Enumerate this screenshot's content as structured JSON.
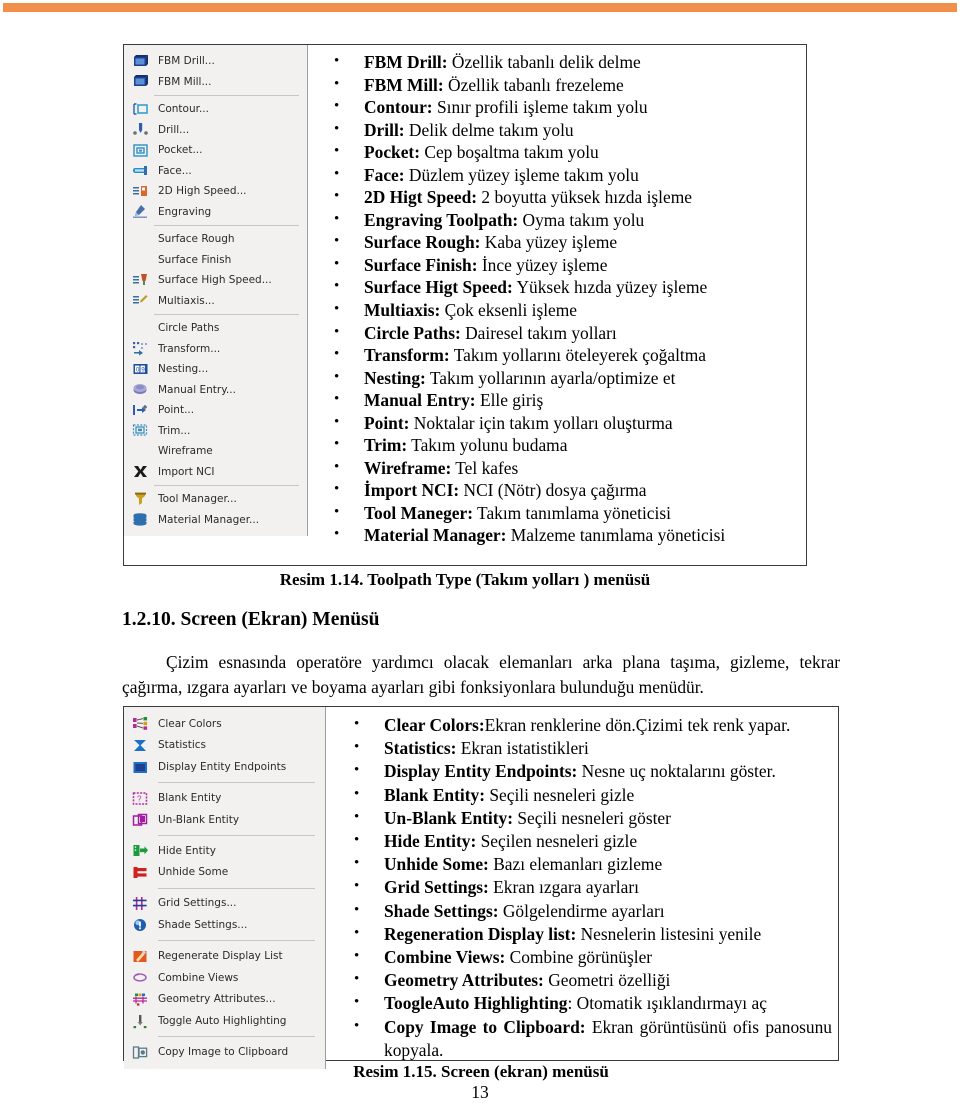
{
  "page": {
    "number": "13",
    "accent_color": "#F2904B",
    "panel_background": "#F2F1F0"
  },
  "figure1": {
    "caption": "Resim 1.14. Toolpath Type (Takım yolları ) menüsü",
    "menu": {
      "groups": [
        {
          "items": [
            {
              "label": "FBM Drill...",
              "icon": "fbm-drill-icon",
              "icon_color": "#1f3f8f"
            },
            {
              "label": "FBM Mill...",
              "icon": "fbm-mill-icon",
              "icon_color": "#1f3f8f"
            }
          ]
        },
        {
          "items": [
            {
              "label": "Contour...",
              "icon": "contour-icon",
              "icon_color": "#3a9fd0"
            },
            {
              "label": "Drill...",
              "icon": "drill-icon",
              "icon_color": "#2c5fae"
            },
            {
              "label": "Pocket...",
              "icon": "pocket-icon",
              "icon_color": "#2f8fc4"
            },
            {
              "label": "Face...",
              "icon": "face-icon",
              "icon_color": "#2f8fc4"
            },
            {
              "label": "2D High Speed...",
              "icon": "two-d-high-speed-icon",
              "icon_color": "#d96a2b"
            },
            {
              "label": "Engraving",
              "icon": "engraving-icon",
              "icon_color": "#4a6ea8"
            }
          ]
        },
        {
          "items": [
            {
              "label": "Surface Rough",
              "icon": "none",
              "icon_color": ""
            },
            {
              "label": "Surface Finish",
              "icon": "none",
              "icon_color": ""
            },
            {
              "label": "Surface High Speed...",
              "icon": "surface-high-speed-icon",
              "icon_color": "#c2512a"
            },
            {
              "label": "Multiaxis...",
              "icon": "multiaxis-icon",
              "icon_color": "#c29a22"
            }
          ]
        },
        {
          "items": [
            {
              "label": "Circle Paths",
              "icon": "none",
              "icon_color": ""
            },
            {
              "label": "Transform...",
              "icon": "transform-icon",
              "icon_color": "#3b5fa8"
            },
            {
              "label": "Nesting...",
              "icon": "nesting-icon",
              "icon_color": "#1f4fa0"
            },
            {
              "label": "Manual Entry...",
              "icon": "manual-entry-icon",
              "icon_color": "#7a7ab8"
            },
            {
              "label": "Point...",
              "icon": "point-icon",
              "icon_color": "#2c5fae"
            },
            {
              "label": "Trim...",
              "icon": "trim-icon",
              "icon_color": "#3a8fc0"
            },
            {
              "label": "Wireframe",
              "icon": "none",
              "icon_color": ""
            },
            {
              "label": "Import NCI",
              "icon": "import-nci-icon",
              "icon_color": "#1a1a1a"
            }
          ]
        },
        {
          "items": [
            {
              "label": "Tool Manager...",
              "icon": "tool-manager-icon",
              "icon_color": "#c8a21e"
            },
            {
              "label": "Material Manager...",
              "icon": "material-manager-icon",
              "icon_color": "#2f6fae"
            }
          ]
        }
      ]
    },
    "bullets": [
      {
        "term": "FBM Drill:",
        "desc": " Özellik tabanlı delik delme"
      },
      {
        "term": "FBM Mill:",
        "desc": " Özellik tabanlı frezeleme"
      },
      {
        "term": "Contour:",
        "desc": " Sınır profili işleme takım yolu"
      },
      {
        "term": "Drill:",
        "desc": " Delik delme takım yolu"
      },
      {
        "term": "Pocket:",
        "desc": " Cep boşaltma takım yolu"
      },
      {
        "term": "Face:",
        "desc": " Düzlem yüzey işleme takım yolu"
      },
      {
        "term": "2D Higt Speed:",
        "desc": " 2 boyutta yüksek hızda işleme"
      },
      {
        "term": "Engraving Toolpath:",
        "desc": " Oyma takım yolu"
      },
      {
        "term": "Surface Rough:",
        "desc": " Kaba yüzey işleme"
      },
      {
        "term": "Surface Finish:",
        "desc": " İnce yüzey işleme"
      },
      {
        "term": "Surface Higt Speed:",
        "desc": " Yüksek hızda yüzey işleme"
      },
      {
        "term": "Multiaxis:",
        "desc": " Çok eksenli işleme"
      },
      {
        "term": "Circle Paths:",
        "desc": " Dairesel takım yolları"
      },
      {
        "term": "Transform:",
        "desc": " Takım yollarını öteleyerek çoğaltma"
      },
      {
        "term": "Nesting:",
        "desc": " Takım yollarının ayarla/optimize et"
      },
      {
        "term": "Manual Entry:",
        "desc": " Elle giriş"
      },
      {
        "term": "Point:",
        "desc": " Noktalar için takım yolları oluşturma"
      },
      {
        "term": "Trim:",
        "desc": " Takım yolunu budama"
      },
      {
        "term": "Wireframe:",
        "desc": " Tel kafes"
      },
      {
        "term": "İmport NCI:",
        "desc": " NCI (Nötr) dosya çağırma"
      },
      {
        "term": "Tool Maneger:",
        "desc": " Takım tanımlama yöneticisi"
      },
      {
        "term": "Material Manager:",
        "desc": " Malzeme tanımlama yöneticisi"
      }
    ]
  },
  "section": {
    "heading": "1.2.10. Screen (Ekran) Menüsü",
    "paragraph": "Çizim esnasında operatöre yardımcı olacak elemanları arka plana taşıma, gizleme, tekrar çağırma, ızgara ayarları ve boyama ayarları gibi fonksiyonlara bulunduğu menüdür."
  },
  "figure2": {
    "caption": "Resim 1.15.  Screen (ekran) menüsü",
    "menu": {
      "groups": [
        {
          "items": [
            {
              "label": "Clear Colors",
              "icon": "clear-colors-icon",
              "icon_color": "#b7299b"
            },
            {
              "label": "Statistics",
              "icon": "statistics-icon",
              "icon_color": "#1f6fc4"
            },
            {
              "label": "Display Entity Endpoints",
              "icon": "display-entity-endpoints-icon",
              "icon_color": "#1f6fc4"
            }
          ]
        },
        {
          "items": [
            {
              "label": "Blank Entity",
              "icon": "blank-entity-icon",
              "icon_color": "#b7299b"
            },
            {
              "label": "Un-Blank Entity",
              "icon": "un-blank-entity-icon",
              "icon_color": "#a01fa0"
            }
          ]
        },
        {
          "items": [
            {
              "label": "Hide Entity",
              "icon": "hide-entity-icon",
              "icon_color": "#1d9a3c"
            },
            {
              "label": "Unhide Some",
              "icon": "unhide-some-icon",
              "icon_color": "#cc2222"
            }
          ]
        },
        {
          "items": [
            {
              "label": "Grid Settings...",
              "icon": "grid-settings-icon",
              "icon_color": "#b7299b"
            },
            {
              "label": "Shade Settings...",
              "icon": "shade-settings-icon",
              "icon_color": "#1f5fb0"
            }
          ]
        },
        {
          "items": [
            {
              "label": "Regenerate Display List",
              "icon": "regenerate-display-list-icon",
              "icon_color": "#e2581f"
            },
            {
              "label": "Combine Views",
              "icon": "combine-views-icon",
              "icon_color": "#9b59b6"
            },
            {
              "label": "Geometry Attributes...",
              "icon": "geometry-attributes-icon",
              "icon_color": "#b7299b"
            },
            {
              "label": "Toggle Auto Highlighting",
              "icon": "toggle-auto-highlighting-icon",
              "icon_color": "#3a7a3a"
            }
          ]
        },
        {
          "items": [
            {
              "label": "Copy Image to Clipboard",
              "icon": "copy-image-to-clipboard-icon",
              "icon_color": "#5a7a8a"
            }
          ]
        }
      ]
    },
    "bullets": [
      {
        "term": "Clear Colors:",
        "desc": "Ekran renklerine dön.Çizimi tek renk yapar."
      },
      {
        "term": "Statistics:",
        "desc": " Ekran istatistikleri"
      },
      {
        "term": "Display Entity Endpoints:",
        "desc": " Nesne uç noktalarını göster."
      },
      {
        "term": "Blank Entity:",
        "desc": " Seçili nesneleri gizle"
      },
      {
        "term": "Un-Blank Entity:",
        "desc": " Seçili nesneleri göster"
      },
      {
        "term": "Hide Entity:",
        "desc": " Seçilen nesneleri gizle"
      },
      {
        "term": "Unhide Some:",
        "desc": " Bazı elemanları gizleme"
      },
      {
        "term": "Grid Settings:",
        "desc": " Ekran ızgara ayarları"
      },
      {
        "term": "Shade Settings:",
        "desc": " Gölgelendirme ayarları"
      },
      {
        "term": "Regeneration Display list:",
        "desc": " Nesnelerin listesini yenile"
      },
      {
        "term": "Combine Views:",
        "desc": " Combine görünüşler"
      },
      {
        "term": "Geometry Attributes:",
        "desc": " Geometri özelliği"
      },
      {
        "term": "ToogleAuto Highlighting",
        "desc": ": Otomatik ışıklandırmayı aç"
      },
      {
        "term": "Copy Image to Clipboard:",
        "desc": " Ekran görüntüsünü ofis panosunu kopyala."
      }
    ]
  }
}
